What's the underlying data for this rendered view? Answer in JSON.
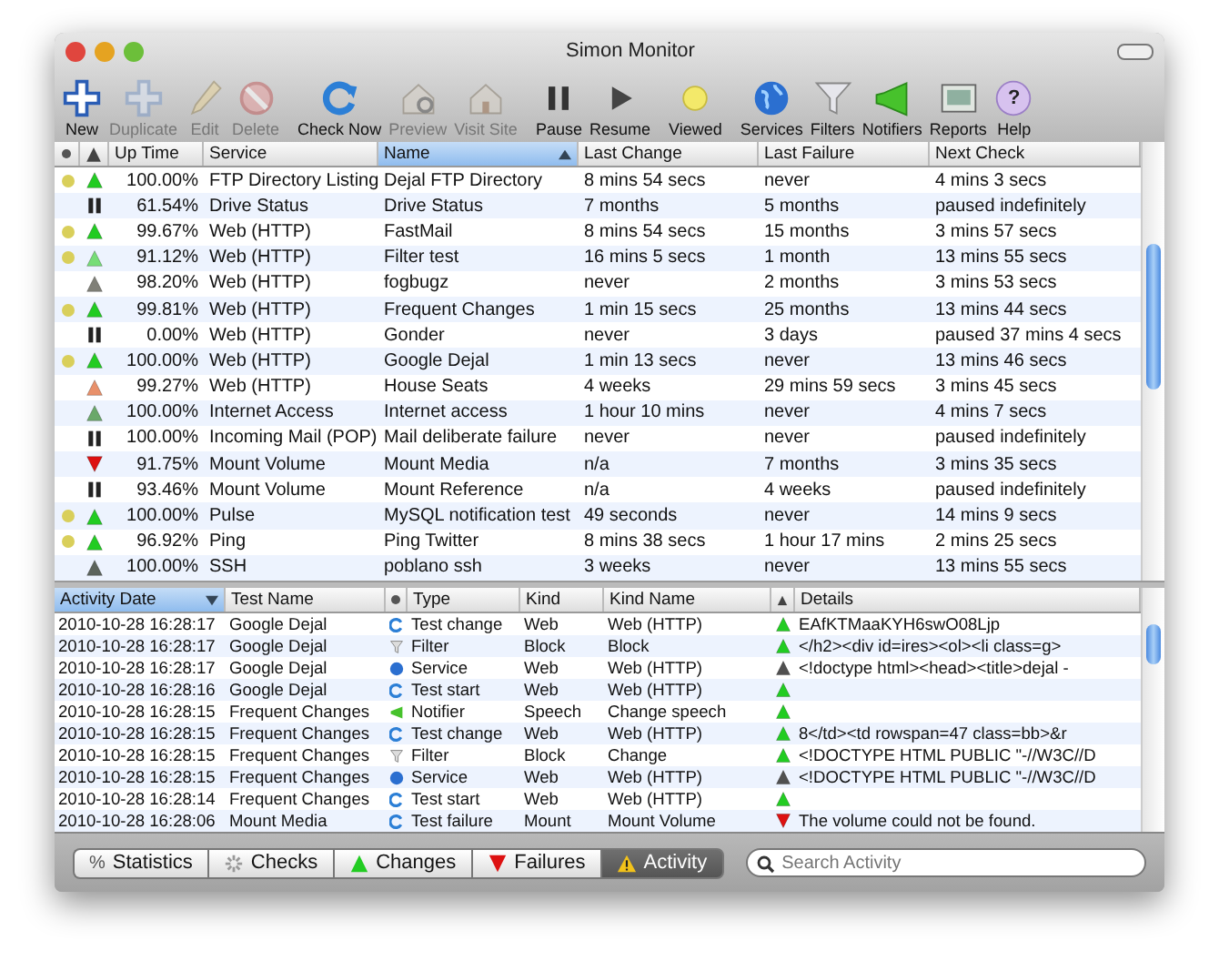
{
  "window": {
    "title": "Simon Monitor"
  },
  "toolbar": [
    {
      "label": "New",
      "disabled": false
    },
    {
      "label": "Duplicate",
      "disabled": true
    },
    {
      "label": "Edit",
      "disabled": true
    },
    {
      "label": "Delete",
      "disabled": true
    },
    {
      "label": "Check Now",
      "disabled": false
    },
    {
      "label": "Preview",
      "disabled": true
    },
    {
      "label": "Visit Site",
      "disabled": true
    },
    {
      "label": "Pause",
      "disabled": false
    },
    {
      "label": "Resume",
      "disabled": false
    },
    {
      "label": "Viewed",
      "disabled": false
    },
    {
      "label": "Services",
      "disabled": false
    },
    {
      "label": "Filters",
      "disabled": false
    },
    {
      "label": "Notifiers",
      "disabled": false
    },
    {
      "label": "Reports",
      "disabled": false
    },
    {
      "label": "Help",
      "disabled": false,
      "glyph": "?"
    }
  ],
  "tests_table": {
    "columns": [
      {
        "label": "Up Time",
        "selected": false
      },
      {
        "label": "Service",
        "selected": false
      },
      {
        "label": "Name",
        "selected": true
      },
      {
        "label": "Last Change",
        "selected": false
      },
      {
        "label": "Last Failure",
        "selected": false
      },
      {
        "label": "Next Check",
        "selected": false
      }
    ],
    "rows": [
      {
        "viewed": true,
        "kind": "up",
        "color": "#22cc22",
        "uptime": "100.00%",
        "service": "FTP Directory Listing",
        "name": "Dejal FTP Directory",
        "last_change": "8 mins 54 secs",
        "last_failure": "never",
        "next_check": "4 mins 3 secs"
      },
      {
        "viewed": false,
        "kind": "paused",
        "uptime": "61.54%",
        "service": "Drive Status",
        "name": "Drive Status",
        "last_change": "7 months",
        "last_failure": "5 months",
        "next_check": "paused indefinitely"
      },
      {
        "viewed": true,
        "kind": "up",
        "color": "#22cc22",
        "uptime": "99.67%",
        "service": "Web (HTTP)",
        "name": "FastMail",
        "last_change": "8 mins 54 secs",
        "last_failure": "15 months",
        "next_check": "3 mins 57 secs"
      },
      {
        "viewed": true,
        "kind": "up",
        "color": "#77dd77",
        "uptime": "91.12%",
        "service": "Web (HTTP)",
        "name": "Filter test",
        "last_change": "16 mins 5 secs",
        "last_failure": "1 month",
        "next_check": "13 mins 55 secs"
      },
      {
        "viewed": false,
        "kind": "up",
        "color": "#808078",
        "uptime": "98.20%",
        "service": "Web (HTTP)",
        "name": "fogbugz",
        "last_change": "never",
        "last_failure": "2 months",
        "next_check": "3 mins 53 secs"
      },
      {
        "viewed": true,
        "kind": "up",
        "color": "#22cc22",
        "uptime": "99.81%",
        "service": "Web (HTTP)",
        "name": "Frequent Changes",
        "last_change": "1 min 15 secs",
        "last_failure": "25 months",
        "next_check": "13 mins 44 secs"
      },
      {
        "viewed": false,
        "kind": "paused",
        "uptime": "0.00%",
        "service": "Web (HTTP)",
        "name": "Gonder",
        "last_change": "never",
        "last_failure": "3 days",
        "next_check": "paused 37 mins 4 secs"
      },
      {
        "viewed": true,
        "kind": "up",
        "color": "#22cc22",
        "uptime": "100.00%",
        "service": "Web (HTTP)",
        "name": "Google Dejal",
        "last_change": "1 min 13 secs",
        "last_failure": "never",
        "next_check": "13 mins 46 secs"
      },
      {
        "viewed": false,
        "kind": "up",
        "color": "#e8906a",
        "uptime": "99.27%",
        "service": "Web (HTTP)",
        "name": "House Seats",
        "last_change": "4 weeks",
        "last_failure": "29 mins 59 secs",
        "next_check": "3 mins 45 secs"
      },
      {
        "viewed": false,
        "kind": "up",
        "color": "#6aa86a",
        "uptime": "100.00%",
        "service": "Internet Access",
        "name": "Internet access",
        "last_change": "1 hour 10 mins",
        "last_failure": "never",
        "next_check": "4 mins 7 secs"
      },
      {
        "viewed": false,
        "kind": "paused",
        "uptime": "100.00%",
        "service": "Incoming Mail (POP)",
        "name": "Mail deliberate failure",
        "last_change": "never",
        "last_failure": "never",
        "next_check": "paused indefinitely"
      },
      {
        "viewed": false,
        "kind": "down",
        "color": "#dd1111",
        "uptime": "91.75%",
        "service": "Mount Volume",
        "name": "Mount Media",
        "last_change": "n/a",
        "last_failure": "7 months",
        "next_check": "3 mins 35 secs"
      },
      {
        "viewed": false,
        "kind": "paused",
        "uptime": "93.46%",
        "service": "Mount Volume",
        "name": "Mount Reference",
        "last_change": "n/a",
        "last_failure": "4 weeks",
        "next_check": "paused indefinitely"
      },
      {
        "viewed": true,
        "kind": "up",
        "color": "#22cc22",
        "uptime": "100.00%",
        "service": "Pulse",
        "name": "MySQL notification test",
        "last_change": "49 seconds",
        "last_failure": "never",
        "next_check": "14 mins 9 secs"
      },
      {
        "viewed": true,
        "kind": "up",
        "color": "#22cc22",
        "uptime": "96.92%",
        "service": "Ping",
        "name": "Ping Twitter",
        "last_change": "8 mins 38 secs",
        "last_failure": "1 hour 17 mins",
        "next_check": "2 mins 25 secs"
      },
      {
        "viewed": false,
        "kind": "up",
        "color": "#5c645c",
        "uptime": "100.00%",
        "service": "SSH",
        "name": "poblano ssh",
        "last_change": "3 weeks",
        "last_failure": "never",
        "next_check": "13 mins 55 secs"
      }
    ]
  },
  "activity_table": {
    "columns": [
      {
        "label": "Activity Date",
        "selected": true
      },
      {
        "label": "Test Name",
        "selected": false
      },
      {
        "label": "Type",
        "selected": false
      },
      {
        "label": "Kind",
        "selected": false
      },
      {
        "label": "Kind Name",
        "selected": false
      },
      {
        "label": "Details",
        "selected": false
      }
    ],
    "rows": [
      {
        "date": "2010-10-28 16:28:17",
        "test": "Google Dejal",
        "kind": "check",
        "type": "Test change",
        "kind_column": "Web",
        "kind_name": "Web (HTTP)",
        "failed": false,
        "color": "#22cc22",
        "details": "EAfKTMaaKYH6swO08Ljp"
      },
      {
        "date": "2010-10-28 16:28:17",
        "test": "Google Dejal",
        "kind": "filter",
        "type": "Filter",
        "kind_column": "Block",
        "kind_name": "Block",
        "failed": false,
        "color": "#22cc22",
        "details": "</h2><div id=ires><ol><li class=g>"
      },
      {
        "date": "2010-10-28 16:28:17",
        "test": "Google Dejal",
        "kind": "service",
        "type": "Service",
        "kind_column": "Web",
        "kind_name": "Web (HTTP)",
        "failed": false,
        "color": "#505050",
        "details": "<!doctype html><head><title>dejal -"
      },
      {
        "date": "2010-10-28 16:28:16",
        "test": "Google Dejal",
        "kind": "check",
        "type": "Test start",
        "kind_column": "Web",
        "kind_name": "Web (HTTP)",
        "failed": false,
        "color": "#22cc22"
      },
      {
        "date": "2010-10-28 16:28:15",
        "test": "Frequent Changes",
        "kind": "notifier",
        "type": "Notifier",
        "kind_column": "Speech",
        "kind_name": "Change speech",
        "failed": false,
        "color": "#22cc22"
      },
      {
        "date": "2010-10-28 16:28:15",
        "test": "Frequent Changes",
        "kind": "check",
        "type": "Test change",
        "kind_column": "Web",
        "kind_name": "Web (HTTP)",
        "failed": false,
        "color": "#22cc22",
        "details": "8</td><td rowspan=47 class=bb>&r"
      },
      {
        "date": "2010-10-28 16:28:15",
        "test": "Frequent Changes",
        "kind": "filter",
        "type": "Filter",
        "kind_column": "Block",
        "kind_name": "Change",
        "failed": false,
        "color": "#22cc22",
        "details": "<!DOCTYPE HTML PUBLIC \"-//W3C//D"
      },
      {
        "date": "2010-10-28 16:28:15",
        "test": "Frequent Changes",
        "kind": "service",
        "type": "Service",
        "kind_column": "Web",
        "kind_name": "Web (HTTP)",
        "failed": false,
        "color": "#505050",
        "details": "<!DOCTYPE HTML PUBLIC \"-//W3C//D"
      },
      {
        "date": "2010-10-28 16:28:14",
        "test": "Frequent Changes",
        "kind": "check",
        "type": "Test start",
        "kind_column": "Web",
        "kind_name": "Web (HTTP)",
        "failed": false,
        "color": "#22cc22"
      },
      {
        "date": "2010-10-28 16:28:06",
        "test": "Mount Media",
        "kind": "check",
        "type": "Test failure",
        "kind_column": "Mount",
        "kind_name": "Mount Volume",
        "failed": true,
        "color": "#dd1111",
        "details": "The volume could not be found."
      }
    ]
  },
  "view_tabs": [
    {
      "label": "Statistics",
      "selected": false,
      "glyph": "%"
    },
    {
      "label": "Checks",
      "selected": false
    },
    {
      "label": "Changes",
      "selected": false
    },
    {
      "label": "Failures",
      "selected": false
    },
    {
      "label": "Activity",
      "selected": true
    }
  ],
  "search": {
    "placeholder": "Search Activity"
  }
}
